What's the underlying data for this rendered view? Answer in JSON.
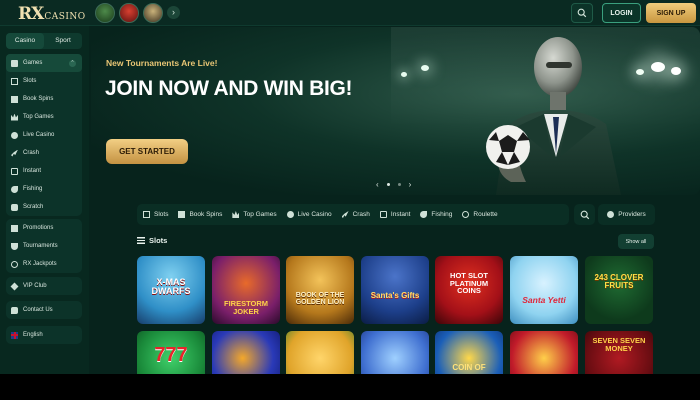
{
  "header": {
    "logo_mark": "RX",
    "logo_text": "CASINO",
    "login_label": "LOGIN",
    "signup_label": "SIGN UP",
    "arrow": "›"
  },
  "sidebar": {
    "tabs": [
      "Casino",
      "Sport"
    ],
    "games_section": [
      {
        "label": "Games",
        "icon": "games-icon"
      },
      {
        "label": "Slots",
        "icon": "slots-icon"
      },
      {
        "label": "Book Spins",
        "icon": "book-icon"
      },
      {
        "label": "Top Games",
        "icon": "crown-icon"
      },
      {
        "label": "Live Casino",
        "icon": "live-icon"
      },
      {
        "label": "Crash",
        "icon": "rocket-icon"
      },
      {
        "label": "Instant",
        "icon": "instant-icon"
      },
      {
        "label": "Fishing",
        "icon": "fish-icon"
      },
      {
        "label": "Scratch",
        "icon": "scratch-icon"
      }
    ],
    "promo_section": [
      {
        "label": "Promotions",
        "icon": "gift-icon"
      },
      {
        "label": "Tournaments",
        "icon": "trophy-icon"
      },
      {
        "label": "RX Jackpots",
        "icon": "jackpot-icon"
      }
    ],
    "vip_label": "VIP Club",
    "contact_label": "Contact Us",
    "language_label": "English"
  },
  "hero": {
    "eyebrow": "New Tournaments Are Live!",
    "title": "JOIN NOW AND WIN BIG!",
    "cta_label": "GET STARTED",
    "prev": "‹",
    "next": "›"
  },
  "categories": [
    {
      "label": "Slots",
      "icon": "slots-icon"
    },
    {
      "label": "Book Spins",
      "icon": "book-icon"
    },
    {
      "label": "Top Games",
      "icon": "crown-icon"
    },
    {
      "label": "Live Casino",
      "icon": "live-icon"
    },
    {
      "label": "Crash",
      "icon": "rocket-icon"
    },
    {
      "label": "Instant",
      "icon": "instant-icon"
    },
    {
      "label": "Fishing",
      "icon": "fish-icon"
    },
    {
      "label": "Roulette",
      "icon": "roulette-icon"
    }
  ],
  "providers_label": "Providers",
  "slots_section": {
    "title": "Slots",
    "show_all": "Show all",
    "games_row1": [
      {
        "title": "X-MAS DWARFS",
        "bg": "#2f8fc7"
      },
      {
        "title": "FIRESTORM JOKER",
        "bg": "#7a1f6a"
      },
      {
        "title": "BOOK OF THE GOLDEN LION",
        "bg": "#b5781c"
      },
      {
        "title": "Santa's Gifts",
        "bg": "#1d3f8a"
      },
      {
        "title": "HOT SLOT PLATINUM COINS",
        "bg": "#a31018"
      },
      {
        "title": "Santa Yetti",
        "bg": "#8fd3f0"
      },
      {
        "title": "243 CLOVER FRUITS",
        "bg": "#0e3a1c"
      }
    ],
    "games_row2": [
      {
        "title": "777",
        "bg": "#1a8a3a"
      },
      {
        "title": "",
        "bg": "#2a3ab8"
      },
      {
        "title": "",
        "bg": "#e0a42a"
      },
      {
        "title": "",
        "bg": "#3f6fd0"
      },
      {
        "title": "COIN OF",
        "bg": "#1b5fb8"
      },
      {
        "title": "",
        "bg": "#c11b2a"
      },
      {
        "title": "SEVEN SEVEN MONEY",
        "bg": "#6a0d12"
      }
    ]
  }
}
